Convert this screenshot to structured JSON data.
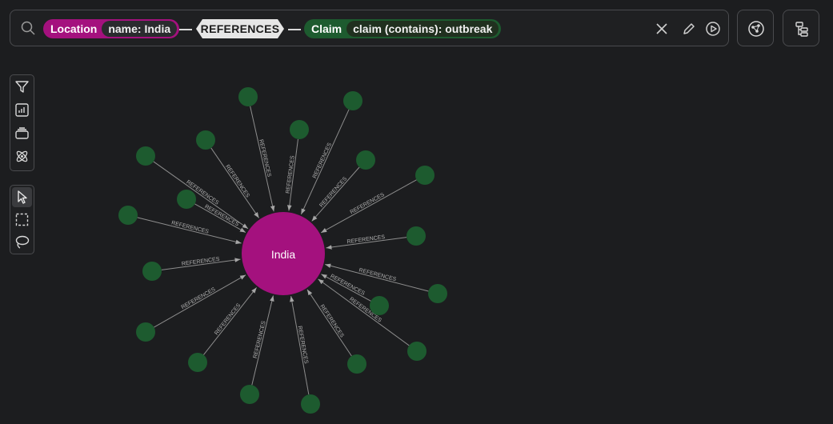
{
  "search": {
    "icon": "search-icon",
    "node1": {
      "label": "Location",
      "property": "name: India",
      "color": "#a4117e"
    },
    "relationship": {
      "label": "REFERENCES"
    },
    "node2": {
      "label": "Claim",
      "property": "claim (contains): outbreak",
      "color": "#1d5b2f"
    },
    "actions": [
      "close-icon",
      "pencil-icon",
      "play-icon"
    ]
  },
  "top_buttons": [
    "graph-style-icon",
    "hierarchy-icon"
  ],
  "toolbar": {
    "group1": [
      "filter-icon",
      "chart-icon",
      "layers-icon",
      "atom-icon"
    ],
    "group2": [
      "pointer-icon",
      "box-select-icon",
      "lasso-icon"
    ],
    "active_tool": "pointer-icon"
  },
  "graph": {
    "center": {
      "label": "India",
      "color": "#a4117e"
    },
    "edge_label": "REFERENCES",
    "leaf_color": "#1d5b2f",
    "leaf_count": 24
  }
}
